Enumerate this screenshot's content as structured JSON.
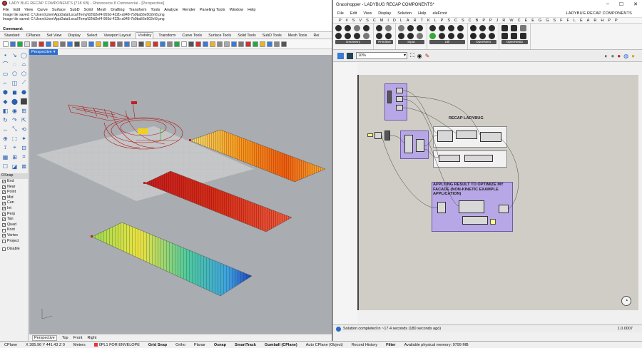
{
  "rhino": {
    "title": "LADY BUG RECAP COMPONENTS (718 KB) - Rhinoceros 8 Commercial - [Perspective]",
    "menu": [
      "File",
      "Edit",
      "View",
      "Curve",
      "Surface",
      "SubD",
      "Solid",
      "Mesh",
      "Drafting",
      "Transform",
      "Tools",
      "Analyze",
      "Render",
      "Paneling Tools",
      "Window",
      "Help"
    ],
    "history": [
      "Image tile saved: C:\\Users\\User\\AppData\\Local\\Temp\\02fd2ef4-955d-422b-a948-7b9ba56e502e\\8.png",
      "Image tile saved: C:\\Users\\User\\AppData\\Local\\Temp\\02fd2ef4-955d-422b-a948-7b9ba56e502e\\9.png"
    ],
    "command_label": "Command:",
    "toolbar_tabs": [
      "Standard",
      "CPlanes",
      "Set View",
      "Display",
      "Select",
      "Viewport Layout",
      "Visibility",
      "Transform",
      "Curve Tools",
      "Surface Tools",
      "Solid Tools",
      "SubD Tools",
      "Mesh Tools",
      "Rei"
    ],
    "active_tab": "Visibility",
    "viewport_name": "Perspective",
    "viewport_tabs": [
      "Perspective",
      "Top",
      "Front",
      "Right"
    ],
    "osnap_title": "OSnap",
    "osnap": [
      {
        "label": "End",
        "checked": true
      },
      {
        "label": "Near",
        "checked": true
      },
      {
        "label": "Point",
        "checked": true
      },
      {
        "label": "Mid",
        "checked": true
      },
      {
        "label": "Cen",
        "checked": true
      },
      {
        "label": "Int",
        "checked": true
      },
      {
        "label": "Perp",
        "checked": true
      },
      {
        "label": "Tan",
        "checked": true
      },
      {
        "label": "Quad",
        "checked": true
      },
      {
        "label": "Knot",
        "checked": false
      },
      {
        "label": "Vertex",
        "checked": true
      },
      {
        "label": "Project",
        "checked": false
      }
    ],
    "disable_label": "Disable"
  },
  "status": {
    "cplane": "CPlane",
    "coords": "X 385.96  Y 441.43  Z 0",
    "units": "Meters",
    "layer": "0PL1 FOR ENVELOPE",
    "items": [
      "Grid Snap",
      "Ortho",
      "Planar",
      "Osnap",
      "SmartTrack",
      "Gumball (CPlane)",
      "Auto CPlane (Object)",
      "Record History",
      "Filter"
    ],
    "bold_items": [
      "Grid Snap",
      "Osnap",
      "SmartTrack",
      "Gumball (CPlane)",
      "Filter"
    ],
    "memory": "Available physical memory: 9799 MB"
  },
  "gh": {
    "title": "Grasshopper - LADYBUG RECAP COMPONENTS*",
    "menu": [
      "File",
      "Edit",
      "View",
      "Display",
      "Solution",
      "Help",
      "eleFront"
    ],
    "doc_name": "LADYBUG RECAP COMPONENTS",
    "category_tabs": [
      "P",
      "#",
      "S",
      "V",
      "S",
      "C",
      "M",
      "I",
      "D",
      "L",
      "A",
      "R",
      "T",
      "K",
      "L",
      "P",
      "S",
      "C",
      "S",
      "C",
      "B",
      "P",
      "P",
      "J",
      "R",
      "W",
      "C",
      "E",
      "E",
      "G",
      "G",
      "S",
      "F",
      "F",
      "L",
      "E",
      "A",
      "R",
      "H",
      "P",
      "P"
    ],
    "groups": [
      "Geometry",
      "Primitive",
      "Input",
      "Util",
      "OpenNest",
      "OpenNest2"
    ],
    "zoom": "10%",
    "canvas_labels": {
      "recap": "RECAP LADYBUG",
      "optimize": "APPLYING RESULT TO OPTIMIZE MY FACADE (NON-KINETIC EXAMPLE APPLICATION)"
    },
    "status": "Solution completed in ~17.4 seconds (180 seconds ago)",
    "version": "1.0.0007"
  },
  "colors": {
    "rhino_viewport": "#a9acb0",
    "gh_canvas": "#d0cdc6",
    "gh_group_purple": "#b4a0eb",
    "accent_blue": "#2f6fd0"
  }
}
